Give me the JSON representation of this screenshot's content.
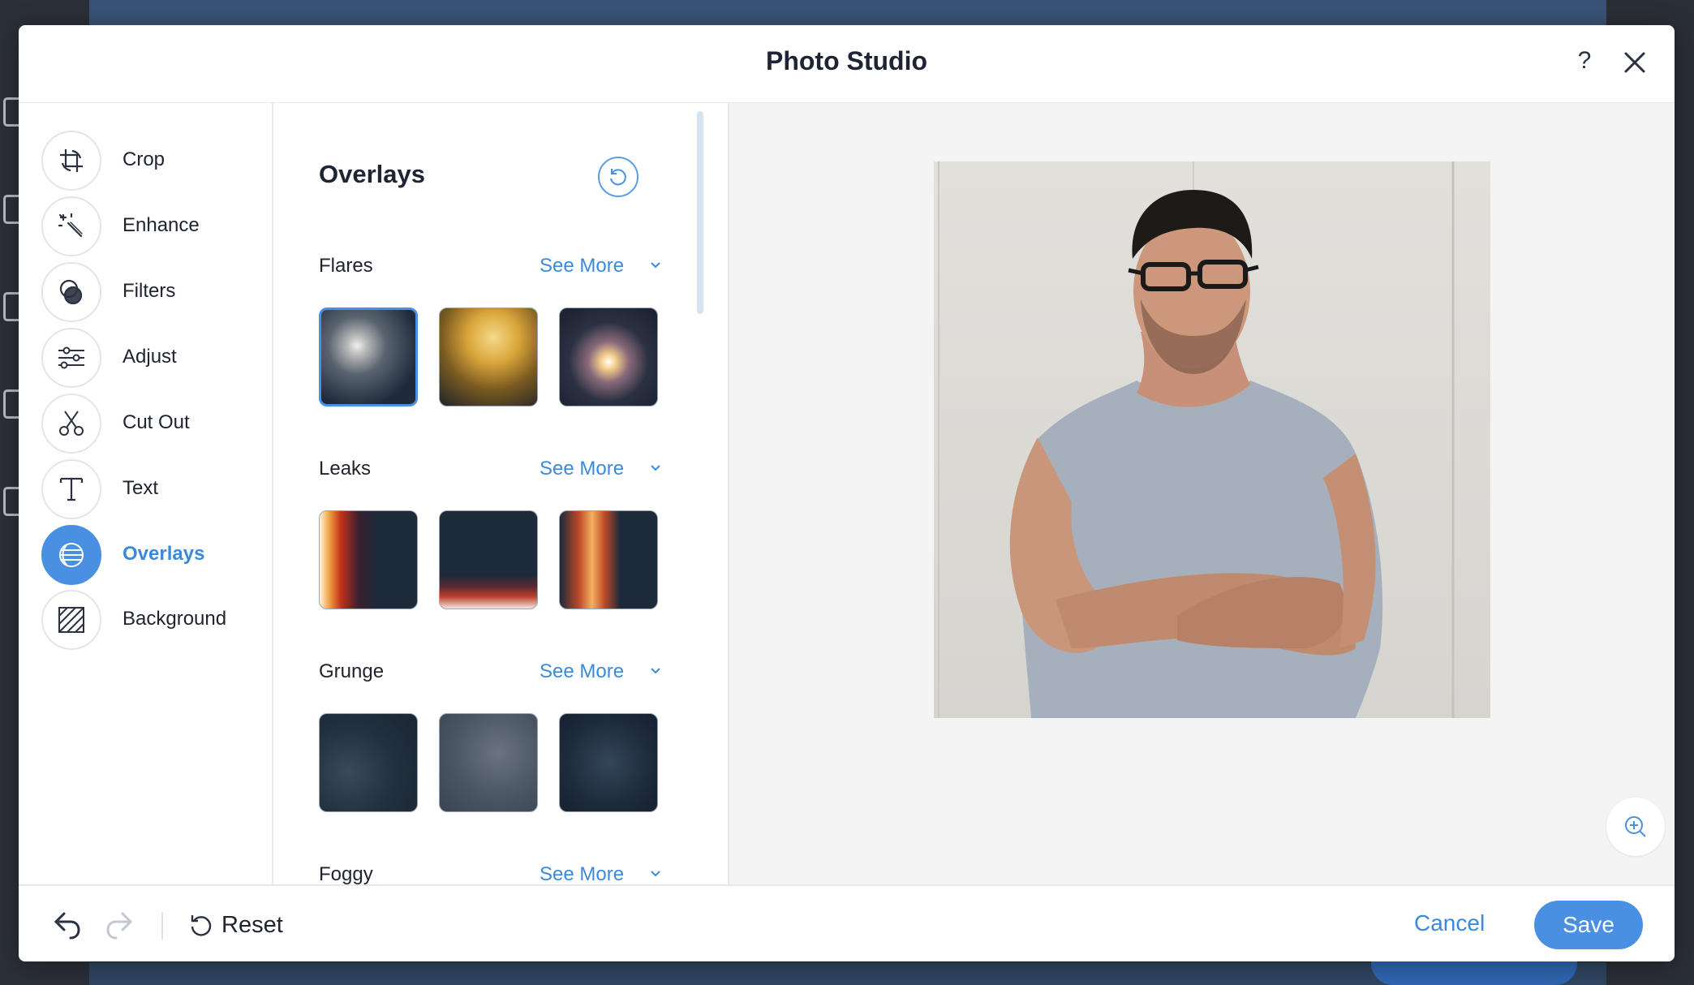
{
  "dialog": {
    "title": "Photo Studio",
    "help_label": "?"
  },
  "tools": [
    {
      "label": "Crop",
      "icon": "crop-icon",
      "active": false
    },
    {
      "label": "Enhance",
      "icon": "magic-wand-icon",
      "active": false
    },
    {
      "label": "Filters",
      "icon": "filters-icon",
      "active": false
    },
    {
      "label": "Adjust",
      "icon": "sliders-icon",
      "active": false
    },
    {
      "label": "Cut Out",
      "icon": "scissors-icon",
      "active": false
    },
    {
      "label": "Text",
      "icon": "text-icon",
      "active": false
    },
    {
      "label": "Overlays",
      "icon": "overlays-icon",
      "active": true
    },
    {
      "label": "Background",
      "icon": "background-pattern-icon",
      "active": false
    }
  ],
  "panel": {
    "title": "Overlays",
    "categories": [
      {
        "label": "Flares",
        "see_more": "See More"
      },
      {
        "label": "Leaks",
        "see_more": "See More"
      },
      {
        "label": "Grunge",
        "see_more": "See More"
      },
      {
        "label": "Foggy",
        "see_more": "See More"
      }
    ]
  },
  "footer": {
    "reset_label": "Reset",
    "cancel_label": "Cancel",
    "save_label": "Save"
  },
  "colors": {
    "accent": "#4a90e2",
    "link": "#3b8ad9",
    "text": "#20242e"
  }
}
